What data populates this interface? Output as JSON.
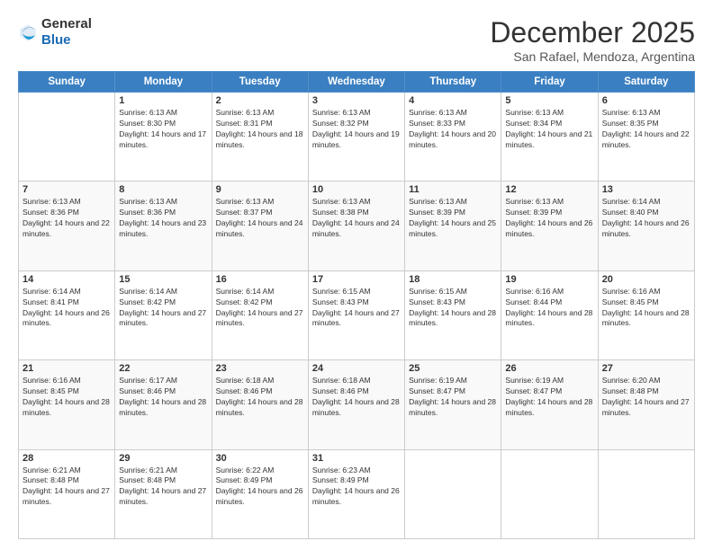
{
  "logo": {
    "general": "General",
    "blue": "Blue"
  },
  "title": "December 2025",
  "subtitle": "San Rafael, Mendoza, Argentina",
  "days_of_week": [
    "Sunday",
    "Monday",
    "Tuesday",
    "Wednesday",
    "Thursday",
    "Friday",
    "Saturday"
  ],
  "weeks": [
    [
      {
        "day": "",
        "sunrise": "",
        "sunset": "",
        "daylight": ""
      },
      {
        "day": "1",
        "sunrise": "Sunrise: 6:13 AM",
        "sunset": "Sunset: 8:30 PM",
        "daylight": "Daylight: 14 hours and 17 minutes."
      },
      {
        "day": "2",
        "sunrise": "Sunrise: 6:13 AM",
        "sunset": "Sunset: 8:31 PM",
        "daylight": "Daylight: 14 hours and 18 minutes."
      },
      {
        "day": "3",
        "sunrise": "Sunrise: 6:13 AM",
        "sunset": "Sunset: 8:32 PM",
        "daylight": "Daylight: 14 hours and 19 minutes."
      },
      {
        "day": "4",
        "sunrise": "Sunrise: 6:13 AM",
        "sunset": "Sunset: 8:33 PM",
        "daylight": "Daylight: 14 hours and 20 minutes."
      },
      {
        "day": "5",
        "sunrise": "Sunrise: 6:13 AM",
        "sunset": "Sunset: 8:34 PM",
        "daylight": "Daylight: 14 hours and 21 minutes."
      },
      {
        "day": "6",
        "sunrise": "Sunrise: 6:13 AM",
        "sunset": "Sunset: 8:35 PM",
        "daylight": "Daylight: 14 hours and 22 minutes."
      }
    ],
    [
      {
        "day": "7",
        "sunrise": "Sunrise: 6:13 AM",
        "sunset": "Sunset: 8:36 PM",
        "daylight": "Daylight: 14 hours and 22 minutes."
      },
      {
        "day": "8",
        "sunrise": "Sunrise: 6:13 AM",
        "sunset": "Sunset: 8:36 PM",
        "daylight": "Daylight: 14 hours and 23 minutes."
      },
      {
        "day": "9",
        "sunrise": "Sunrise: 6:13 AM",
        "sunset": "Sunset: 8:37 PM",
        "daylight": "Daylight: 14 hours and 24 minutes."
      },
      {
        "day": "10",
        "sunrise": "Sunrise: 6:13 AM",
        "sunset": "Sunset: 8:38 PM",
        "daylight": "Daylight: 14 hours and 24 minutes."
      },
      {
        "day": "11",
        "sunrise": "Sunrise: 6:13 AM",
        "sunset": "Sunset: 8:39 PM",
        "daylight": "Daylight: 14 hours and 25 minutes."
      },
      {
        "day": "12",
        "sunrise": "Sunrise: 6:13 AM",
        "sunset": "Sunset: 8:39 PM",
        "daylight": "Daylight: 14 hours and 26 minutes."
      },
      {
        "day": "13",
        "sunrise": "Sunrise: 6:14 AM",
        "sunset": "Sunset: 8:40 PM",
        "daylight": "Daylight: 14 hours and 26 minutes."
      }
    ],
    [
      {
        "day": "14",
        "sunrise": "Sunrise: 6:14 AM",
        "sunset": "Sunset: 8:41 PM",
        "daylight": "Daylight: 14 hours and 26 minutes."
      },
      {
        "day": "15",
        "sunrise": "Sunrise: 6:14 AM",
        "sunset": "Sunset: 8:42 PM",
        "daylight": "Daylight: 14 hours and 27 minutes."
      },
      {
        "day": "16",
        "sunrise": "Sunrise: 6:14 AM",
        "sunset": "Sunset: 8:42 PM",
        "daylight": "Daylight: 14 hours and 27 minutes."
      },
      {
        "day": "17",
        "sunrise": "Sunrise: 6:15 AM",
        "sunset": "Sunset: 8:43 PM",
        "daylight": "Daylight: 14 hours and 27 minutes."
      },
      {
        "day": "18",
        "sunrise": "Sunrise: 6:15 AM",
        "sunset": "Sunset: 8:43 PM",
        "daylight": "Daylight: 14 hours and 28 minutes."
      },
      {
        "day": "19",
        "sunrise": "Sunrise: 6:16 AM",
        "sunset": "Sunset: 8:44 PM",
        "daylight": "Daylight: 14 hours and 28 minutes."
      },
      {
        "day": "20",
        "sunrise": "Sunrise: 6:16 AM",
        "sunset": "Sunset: 8:45 PM",
        "daylight": "Daylight: 14 hours and 28 minutes."
      }
    ],
    [
      {
        "day": "21",
        "sunrise": "Sunrise: 6:16 AM",
        "sunset": "Sunset: 8:45 PM",
        "daylight": "Daylight: 14 hours and 28 minutes."
      },
      {
        "day": "22",
        "sunrise": "Sunrise: 6:17 AM",
        "sunset": "Sunset: 8:46 PM",
        "daylight": "Daylight: 14 hours and 28 minutes."
      },
      {
        "day": "23",
        "sunrise": "Sunrise: 6:18 AM",
        "sunset": "Sunset: 8:46 PM",
        "daylight": "Daylight: 14 hours and 28 minutes."
      },
      {
        "day": "24",
        "sunrise": "Sunrise: 6:18 AM",
        "sunset": "Sunset: 8:46 PM",
        "daylight": "Daylight: 14 hours and 28 minutes."
      },
      {
        "day": "25",
        "sunrise": "Sunrise: 6:19 AM",
        "sunset": "Sunset: 8:47 PM",
        "daylight": "Daylight: 14 hours and 28 minutes."
      },
      {
        "day": "26",
        "sunrise": "Sunrise: 6:19 AM",
        "sunset": "Sunset: 8:47 PM",
        "daylight": "Daylight: 14 hours and 28 minutes."
      },
      {
        "day": "27",
        "sunrise": "Sunrise: 6:20 AM",
        "sunset": "Sunset: 8:48 PM",
        "daylight": "Daylight: 14 hours and 27 minutes."
      }
    ],
    [
      {
        "day": "28",
        "sunrise": "Sunrise: 6:21 AM",
        "sunset": "Sunset: 8:48 PM",
        "daylight": "Daylight: 14 hours and 27 minutes."
      },
      {
        "day": "29",
        "sunrise": "Sunrise: 6:21 AM",
        "sunset": "Sunset: 8:48 PM",
        "daylight": "Daylight: 14 hours and 27 minutes."
      },
      {
        "day": "30",
        "sunrise": "Sunrise: 6:22 AM",
        "sunset": "Sunset: 8:49 PM",
        "daylight": "Daylight: 14 hours and 26 minutes."
      },
      {
        "day": "31",
        "sunrise": "Sunrise: 6:23 AM",
        "sunset": "Sunset: 8:49 PM",
        "daylight": "Daylight: 14 hours and 26 minutes."
      },
      {
        "day": "",
        "sunrise": "",
        "sunset": "",
        "daylight": ""
      },
      {
        "day": "",
        "sunrise": "",
        "sunset": "",
        "daylight": ""
      },
      {
        "day": "",
        "sunrise": "",
        "sunset": "",
        "daylight": ""
      }
    ]
  ]
}
